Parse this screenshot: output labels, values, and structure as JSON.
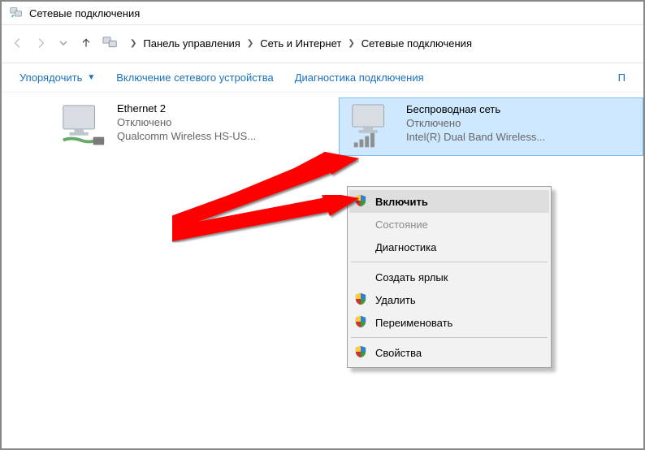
{
  "window": {
    "title": "Сетевые подключения"
  },
  "breadcrumb": {
    "root": "Панель управления",
    "mid": "Сеть и Интернет",
    "leaf": "Сетевые подключения"
  },
  "toolbar": {
    "organize": "Упорядочить",
    "enable_device": "Включение сетевого устройства",
    "diagnose": "Диагностика подключения",
    "truncated": "П"
  },
  "connections": [
    {
      "name": "Ethernet 2",
      "status": "Отключено",
      "device": "Qualcomm Wireless HS-US..."
    },
    {
      "name": "Беспроводная сеть",
      "status": "Отключено",
      "device": "Intel(R) Dual Band Wireless..."
    }
  ],
  "context_menu": {
    "enable": "Включить",
    "status": "Состояние",
    "diagnose": "Диагностика",
    "shortcut": "Создать ярлык",
    "delete": "Удалить",
    "rename": "Переименовать",
    "properties": "Свойства"
  }
}
